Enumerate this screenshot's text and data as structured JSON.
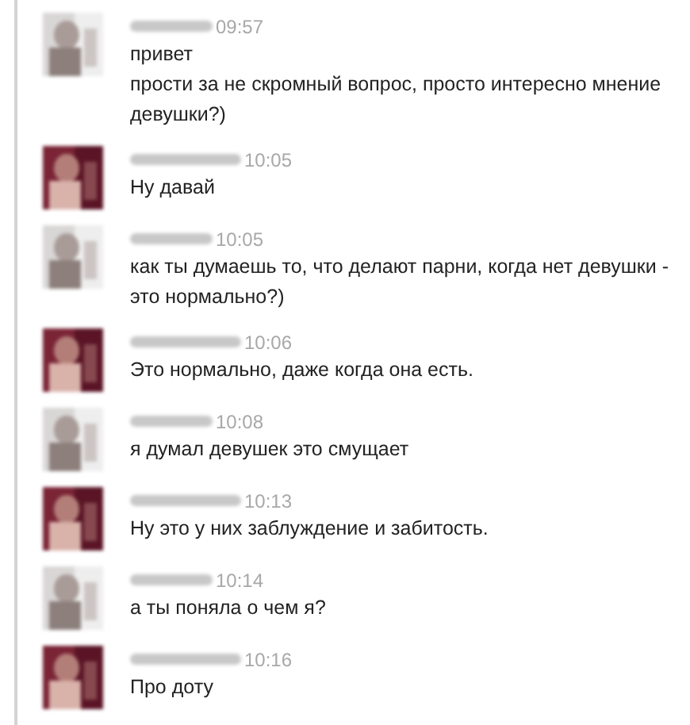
{
  "messages": [
    {
      "kind": "boy",
      "time": "09:57",
      "lines": [
        "привет",
        "прости за не скромный вопрос, просто интересно мнение девушки?)"
      ]
    },
    {
      "kind": "girl",
      "time": "10:05",
      "lines": [
        "Ну давай"
      ]
    },
    {
      "kind": "boy",
      "time": "10:05",
      "lines": [
        "как ты думаешь то, что делают парни, когда нет девушки - это нормально?)"
      ]
    },
    {
      "kind": "girl",
      "time": "10:06",
      "lines": [
        "Это нормально, даже когда она есть."
      ]
    },
    {
      "kind": "boy",
      "time": "10:08",
      "lines": [
        "я думал девушек это смущает"
      ]
    },
    {
      "kind": "girl",
      "time": "10:13",
      "lines": [
        "Ну это у них заблуждение и забитость."
      ]
    },
    {
      "kind": "boy",
      "time": "10:14",
      "lines": [
        "а ты поняла о чем я?"
      ]
    },
    {
      "kind": "girl",
      "time": "10:16",
      "lines": [
        "Про доту"
      ]
    }
  ]
}
